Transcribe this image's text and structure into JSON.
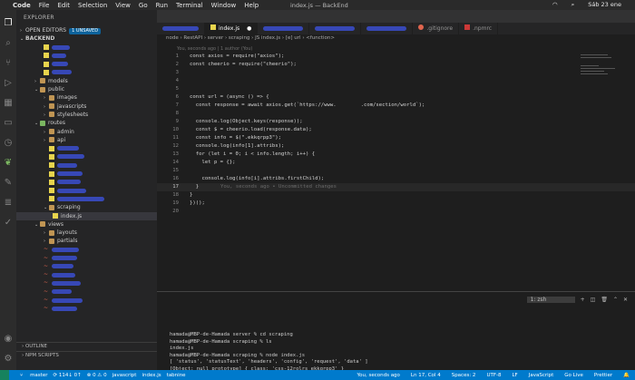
{
  "menubar": {
    "app": "Code",
    "items": [
      "File",
      "Edit",
      "Selection",
      "View",
      "Go",
      "Run",
      "Terminal",
      "Window",
      "Help"
    ],
    "window_title": "index.js — BackEnd",
    "clock": "Sáb 23 ene"
  },
  "sidebar": {
    "title": "EXPLORER",
    "open_editors": "OPEN EDITORS",
    "unsaved": "1 UNSAVED",
    "root": "BACKEND",
    "items": [
      {
        "label": "models",
        "type": "folder"
      },
      {
        "label": "public",
        "type": "folder",
        "open": true
      },
      {
        "label": "images",
        "type": "folder"
      },
      {
        "label": "javascripts",
        "type": "folder"
      },
      {
        "label": "stylesheets",
        "type": "folder"
      },
      {
        "label": "routes",
        "type": "folder",
        "open": true
      },
      {
        "label": "admin",
        "type": "folder"
      },
      {
        "label": "api",
        "type": "folder"
      },
      {
        "label": "scraping",
        "type": "folder",
        "open": true
      },
      {
        "label": "index.js",
        "type": "file"
      },
      {
        "label": "views",
        "type": "folder",
        "open": true
      },
      {
        "label": "layouts",
        "type": "folder"
      },
      {
        "label": "partials",
        "type": "folder"
      }
    ],
    "outline": "OUTLINE",
    "npm_scripts": "NPM SCRIPTS"
  },
  "tabs": [
    {
      "label": "index.js",
      "active": true
    },
    {
      "label": ".gitignore",
      "active": false
    },
    {
      "label": ".npmrc",
      "active": false
    }
  ],
  "breadcrumb": "node › RestAPI › server › scraping › JS index.js › [e] url › <function>",
  "blame": "You, seconds ago | 1 author (You)",
  "code_lines": [
    "const axios = require(\"axios\");",
    "const cheerio = require(\"cheerio\");",
    "",
    "",
    "",
    "const url = (async () => {",
    "  const response = await axios.get(`https://www.        .com/section/world`);",
    "",
    "  console.log(Object.keys(response));",
    "  const $ = cheerio.load(response.data);",
    "  const info = $(\".ekkqrpp3\");",
    "  console.log(info[1].attribs);",
    "  for (let i = 0; i < info.length; i++) {",
    "    let p = {};",
    "",
    "    console.log(info[i].attribs.firstChild);",
    "  }",
    "}",
    "})();",
    ""
  ],
  "inline_blame": "You, seconds ago • Uncommitted changes",
  "terminal": {
    "selector": "1: zsh",
    "lines": [
      "hamada@MBP-de-Hamada server % cd scraping",
      "hamada@MBP-de-Hamada scraping % ls",
      "index.js",
      "hamada@MBP-de-Hamada scraping % node index.js",
      "[ 'status', 'statusText', 'headers', 'config', 'request', 'data' ]",
      "[Object: null prototype] { class: 'css-12rolrs ekkqrpp3' }"
    ]
  },
  "statusbar": {
    "branch": "master",
    "sync": "⟳ 114↓ 0↑",
    "errors": "⊗ 0 ⚠ 0",
    "language_mode": "javascript",
    "file": "index.js",
    "extension": "tabnine",
    "blame": "You, seconds ago",
    "position": "Ln 17, Col 4",
    "spaces": "Spaces: 2",
    "encoding": "UTF-8",
    "eol": "LF",
    "lang": "JavaScript",
    "golive": "Go Live",
    "prettier": "Prettier"
  }
}
